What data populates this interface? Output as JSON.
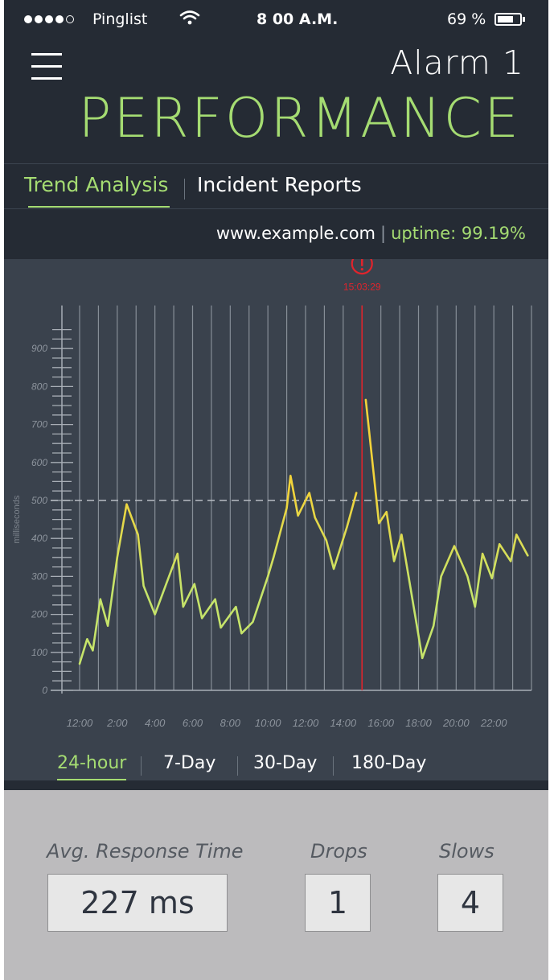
{
  "status_bar": {
    "carrier": "Pinglist",
    "time": "8 00 A.M.",
    "battery_percent": "69 %",
    "battery_level": 0.69,
    "signal_icon": "signal-dots-icon",
    "wifi_icon": "wifi-icon",
    "battery_icon": "battery-icon"
  },
  "header": {
    "menu_icon": "hamburger-menu-icon",
    "alarm_title": "Alarm 1",
    "page_title": "PERFORMANCE"
  },
  "tabs": [
    {
      "label": "Trend Analysis",
      "active": true
    },
    {
      "label": "Incident Reports",
      "active": false
    }
  ],
  "site": {
    "url": "www.example.com",
    "separator": "|",
    "uptime": "uptime: 99.19%"
  },
  "colors": {
    "accent_green": "#a5dc72",
    "line_yellow": "#f2d33a",
    "line_green": "#c6e46a",
    "incident_red": "#e0242c",
    "background_dark": "#252b34",
    "chart_background": "#3a424d"
  },
  "chart_data": {
    "type": "line",
    "ylabel": "milliseconds",
    "ylim": [
      0,
      950
    ],
    "y_ticks": [
      0,
      100,
      200,
      300,
      400,
      500,
      600,
      700,
      800,
      900
    ],
    "xlim": [
      0,
      24
    ],
    "x_ticks": [
      0,
      2,
      4,
      6,
      8,
      10,
      12,
      14,
      16,
      18,
      20,
      22
    ],
    "x_tick_labels": [
      "12:00",
      "2:00",
      "4:00",
      "6:00",
      "8:00",
      "10:00",
      "12:00",
      "14:00",
      "16:00",
      "18:00",
      "20:00",
      "22:00"
    ],
    "threshold": 500,
    "incident": {
      "x": 15.0,
      "label": "15:03:29",
      "icon": "alert-circle-icon"
    },
    "grid": "vertical",
    "series": [
      {
        "segments": [
          [
            [
              0.0,
              70
            ],
            [
              0.4,
              135
            ],
            [
              0.7,
              105
            ],
            [
              1.1,
              240
            ],
            [
              1.5,
              170
            ],
            [
              2.0,
              350
            ],
            [
              2.5,
              490
            ],
            [
              3.1,
              410
            ],
            [
              3.4,
              275
            ],
            [
              4.0,
              200
            ],
            [
              4.6,
              280
            ],
            [
              5.2,
              360
            ],
            [
              5.5,
              220
            ],
            [
              6.1,
              280
            ],
            [
              6.5,
              190
            ],
            [
              7.2,
              240
            ],
            [
              7.5,
              165
            ],
            [
              8.3,
              220
            ],
            [
              8.6,
              150
            ],
            [
              9.2,
              180
            ],
            [
              10.0,
              300
            ],
            [
              10.3,
              350
            ],
            [
              11.0,
              480
            ],
            [
              11.2,
              565
            ],
            [
              11.6,
              460
            ],
            [
              12.2,
              520
            ],
            [
              12.5,
              455
            ],
            [
              13.1,
              395
            ],
            [
              13.5,
              320
            ],
            [
              14.2,
              430
            ],
            [
              14.7,
              520
            ]
          ],
          [
            [
              15.2,
              765
            ],
            [
              15.9,
              440
            ],
            [
              16.3,
              470
            ],
            [
              16.7,
              340
            ],
            [
              17.1,
              410
            ],
            [
              18.2,
              85
            ],
            [
              18.8,
              170
            ],
            [
              19.2,
              300
            ],
            [
              19.9,
              380
            ],
            [
              20.6,
              300
            ],
            [
              21.0,
              220
            ],
            [
              21.4,
              360
            ],
            [
              21.9,
              295
            ],
            [
              22.3,
              385
            ],
            [
              22.9,
              340
            ],
            [
              23.2,
              410
            ],
            [
              23.8,
              355
            ]
          ]
        ]
      }
    ]
  },
  "ranges": [
    {
      "label": "24-hour",
      "active": true
    },
    {
      "label": "7-Day",
      "active": false
    },
    {
      "label": "30-Day",
      "active": false
    },
    {
      "label": "180-Day",
      "active": false
    }
  ],
  "stats": {
    "avg_response": {
      "label": "Avg. Response Time",
      "value": "227 ms"
    },
    "drops": {
      "label": "Drops",
      "value": "1"
    },
    "slows": {
      "label": "Slows",
      "value": "4"
    }
  }
}
